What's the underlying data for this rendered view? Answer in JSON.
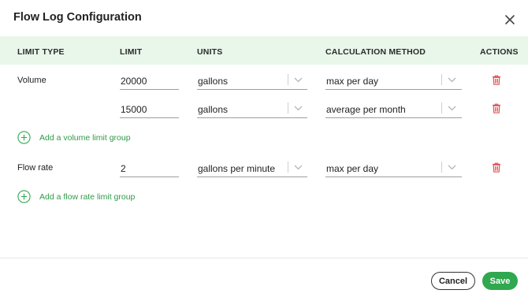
{
  "dialog": {
    "title": "Flow Log Configuration"
  },
  "table": {
    "headers": {
      "limit_type": "LIMIT TYPE",
      "limit": "LIMIT",
      "units": "UNITS",
      "calculation_method": "CALCULATION METHOD",
      "actions": "ACTIONS"
    },
    "rows": [
      {
        "limit_type": "Volume",
        "limit": "20000",
        "units": "gallons",
        "method": "max per day"
      },
      {
        "limit_type": "",
        "limit": "15000",
        "units": "gallons",
        "method": "average per month"
      },
      {
        "limit_type": "Flow rate",
        "limit": "2",
        "units": "gallons per minute",
        "method": "max per day"
      }
    ],
    "add_volume_label": "Add a volume limit group",
    "add_flow_rate_label": "Add a flow rate limit group"
  },
  "footer": {
    "cancel_label": "Cancel",
    "save_label": "Save"
  },
  "colors": {
    "accent": "#2fa84f",
    "header_bg": "#e9f6ea",
    "delete": "#e05454"
  }
}
